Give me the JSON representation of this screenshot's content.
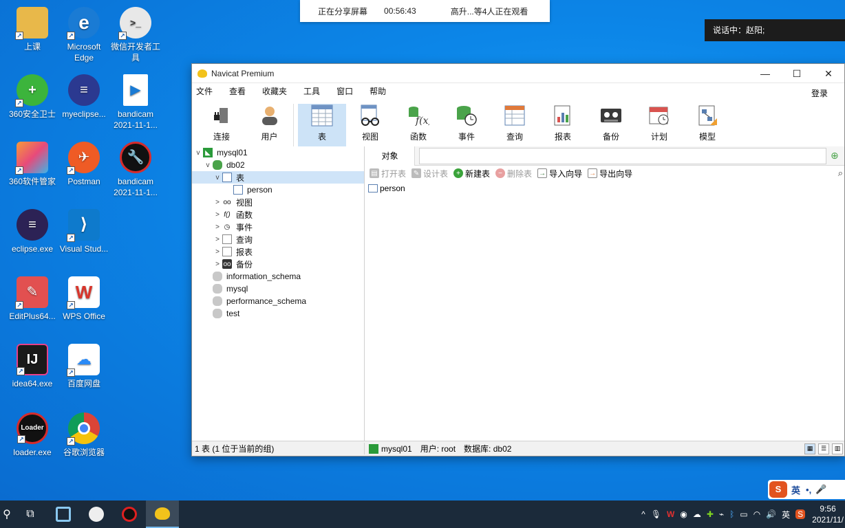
{
  "desktop": {
    "icons": [
      {
        "label": "上课",
        "color": "#e8b84a"
      },
      {
        "label": "Microsoft Edge",
        "color": "#1a7bd4"
      },
      {
        "label": "微信开发者工具",
        "color": "#e8e8e8"
      },
      {
        "label": "360安全卫士",
        "color": "#3cb43c"
      },
      {
        "label": "myeclipse...",
        "color": "#2b3990"
      },
      {
        "label": "bandicam 2021-11-1...",
        "color": "#ffffff"
      },
      {
        "label": "360软件管家",
        "color": "#e84a7a"
      },
      {
        "label": "Postman",
        "color": "#ef5b25"
      },
      {
        "label": "bandicam 2021-11-1...",
        "color": "#111111"
      },
      {
        "label": "eclipse.exe",
        "color": "#2c2255"
      },
      {
        "label": "Visual Stud...",
        "color": "#0e7acc"
      },
      {
        "label": "EditPlus64...",
        "color": "#e25050"
      },
      {
        "label": "WPS Office",
        "color": "#d9352b"
      },
      {
        "label": "idea64.exe",
        "color": "#1a1a1a"
      },
      {
        "label": "百度网盘",
        "color": "#ffffff"
      },
      {
        "label": "loader.exe",
        "color": "#111111"
      },
      {
        "label": "谷歌浏览器",
        "color": "#e0e0e0"
      }
    ]
  },
  "sharebar": {
    "status": "正在分享屏幕",
    "time": "00:56:43",
    "viewers": "高升...等4人正在观看"
  },
  "speaking": "说话中：赵阳;",
  "window": {
    "title": "Navicat Premium",
    "controls": {
      "minimize": "—",
      "maximize": "☐",
      "close": "✕"
    },
    "menu": [
      "文件",
      "查看",
      "收藏夹",
      "工具",
      "窗口",
      "帮助"
    ],
    "login": "登录",
    "toolbar": [
      {
        "label": "连接",
        "icon": "plug-icon"
      },
      {
        "label": "用户",
        "icon": "user-icon"
      },
      {
        "label": "表",
        "icon": "table-icon"
      },
      {
        "label": "视图",
        "icon": "view-icon"
      },
      {
        "label": "函数",
        "icon": "function-icon"
      },
      {
        "label": "事件",
        "icon": "event-icon"
      },
      {
        "label": "查询",
        "icon": "query-icon"
      },
      {
        "label": "报表",
        "icon": "report-icon"
      },
      {
        "label": "备份",
        "icon": "backup-icon"
      },
      {
        "label": "计划",
        "icon": "schedule-icon"
      },
      {
        "label": "模型",
        "icon": "model-icon"
      }
    ],
    "tree": {
      "connection": "mysql01",
      "database": "db02",
      "tables_label": "表",
      "table_item": "person",
      "nodes": [
        "视图",
        "函数",
        "事件",
        "查询",
        "报表",
        "备份"
      ],
      "other_dbs": [
        "information_schema",
        "mysql",
        "performance_schema",
        "test"
      ]
    },
    "objects": {
      "tab": "对象",
      "actions": [
        {
          "label": "打开表",
          "enabled": false
        },
        {
          "label": "设计表",
          "enabled": false
        },
        {
          "label": "新建表",
          "enabled": true
        },
        {
          "label": "删除表",
          "enabled": false
        },
        {
          "label": "导入向导",
          "enabled": true
        },
        {
          "label": "导出向导",
          "enabled": true
        }
      ],
      "items": [
        "person"
      ]
    },
    "status": {
      "count": "1 表 (1 位于当前的组)",
      "connection": "mysql01",
      "user": "用户: root",
      "database": "数据库: db02"
    }
  },
  "ime": {
    "logo": "S",
    "mode": "英"
  },
  "taskbar": {
    "tray_lang": "英",
    "time": "9:56",
    "date": "2021/11/"
  }
}
